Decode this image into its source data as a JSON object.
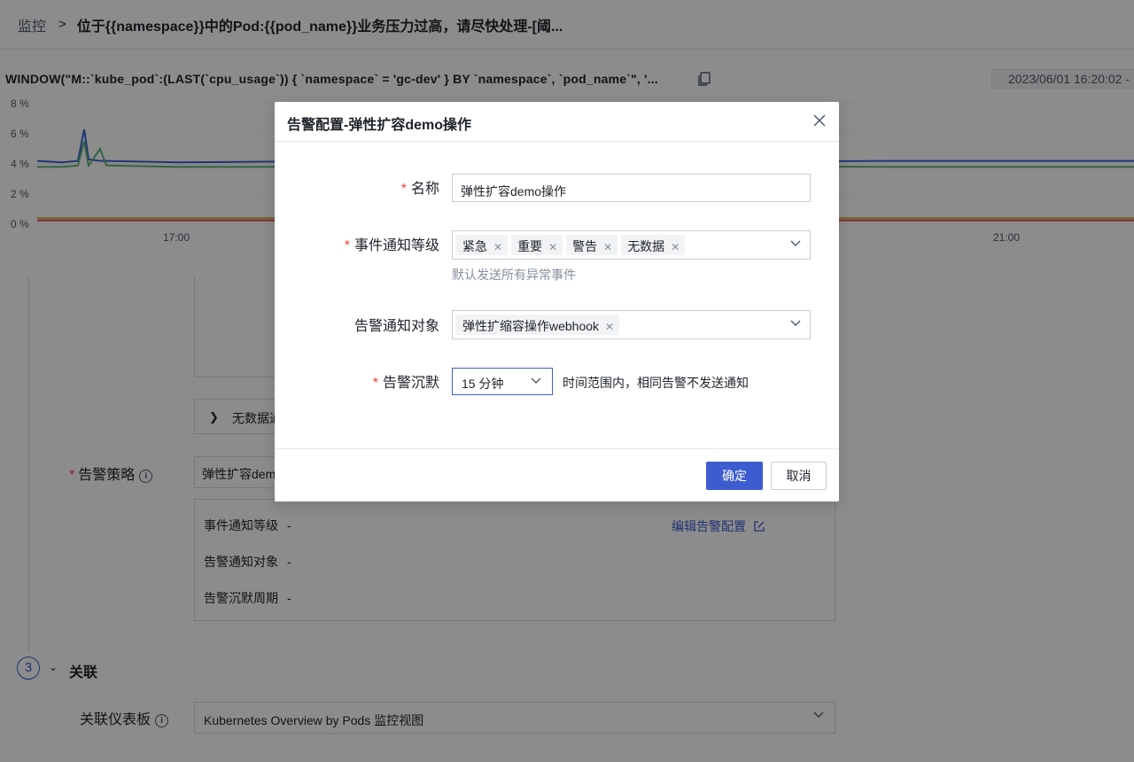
{
  "breadcrumb": {
    "root": "监控",
    "current": "位于{{namespace}}中的Pod:{{pod_name}}业务压力过高，请尽快处理-[阈..."
  },
  "chart": {
    "query": "WINDOW(\"M::`kube_pod`:(LAST(`cpu_usage`)) { `namespace` = 'gc-dev' } BY `namespace`, `pod_name`\", '...",
    "time_range": "2023/06/01 16:20:02 -"
  },
  "chart_data": {
    "type": "line",
    "ylim": [
      0,
      8
    ],
    "y_ticks": [
      "8 %",
      "6 %",
      "4 %",
      "2 %",
      "0 %"
    ],
    "x_ticks": [
      "17:00",
      "21:00"
    ],
    "grid": true,
    "series_colors": [
      "#3b62d6",
      "#5eb37a",
      "#e0a44b",
      "#e0524d"
    ],
    "series": [
      {
        "values": [
          4.2,
          4.1,
          4.2,
          6.3,
          4.3,
          4.2,
          4.2,
          4.1,
          4.2,
          4.1,
          4.2,
          4.2
        ]
      },
      {
        "values": [
          3.8,
          3.8,
          3.9,
          5.5,
          3.9,
          5.0,
          3.9,
          3.8,
          3.8,
          3.9,
          3.8,
          3.8
        ]
      },
      {
        "values": [
          0.4,
          0.4,
          0.4,
          0.4,
          0.4,
          0.4,
          0.4,
          0.4,
          0.4,
          0.4,
          0.4,
          0.4
        ]
      },
      {
        "values": [
          0.25,
          0.25,
          0.25,
          0.25,
          0.25,
          0.25,
          0.25,
          0.25,
          0.25,
          0.25,
          0.25,
          0.25
        ]
      }
    ]
  },
  "form": {
    "nodata_label": "无数据通",
    "policy_label": "告警策略",
    "policy_value": "弹性扩容dem",
    "detail": {
      "level_label": "事件通知等级",
      "target_label": "告警通知对象",
      "silence_label": "告警沉默周期",
      "dash": "-",
      "edit_link": "编辑告警配置"
    },
    "step_number": "3",
    "step_title": "关联",
    "dashboard_label": "关联仪表板",
    "dashboard_value": "Kubernetes Overview by Pods 监控视图"
  },
  "modal": {
    "title": "告警配置-弹性扩容demo操作",
    "name_label": "名称",
    "name_value": "弹性扩容demo操作",
    "level_label": "事件通知等级",
    "level_tags": [
      "紧急",
      "重要",
      "警告",
      "无数据"
    ],
    "level_hint": "默认发送所有异常事件",
    "target_label": "告警通知对象",
    "target_tags": [
      "弹性扩缩容操作webhook"
    ],
    "silence_label": "告警沉默",
    "silence_value": "15 分钟",
    "silence_hint": "时间范围内，相同告警不发送通知",
    "ok_label": "确定",
    "cancel_label": "取消"
  }
}
